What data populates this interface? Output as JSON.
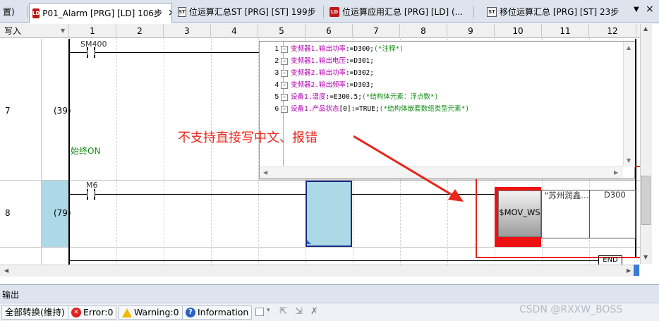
{
  "tabs": [
    {
      "label": "置)",
      "icon": ""
    },
    {
      "label": "P01_Alarm [PRG] [LD] 106步",
      "icon": "LD"
    },
    {
      "label": "位运算汇总ST [PRG] [ST] 199步",
      "icon": "ST"
    },
    {
      "label": "位运算应用汇总 [PRG] [LD] (...",
      "icon": "LD"
    },
    {
      "label": "移位运算汇总 [PRG] [ST] 23步",
      "icon": "ST"
    }
  ],
  "tab_close": "×",
  "tab_controls": {
    "menu": "▼",
    "close": "×"
  },
  "header": {
    "mode_label": "写入",
    "columns": [
      "1",
      "2",
      "3",
      "4",
      "5",
      "6",
      "7",
      "8",
      "9",
      "10",
      "11",
      "12"
    ]
  },
  "rows": [
    {
      "row_number": "7",
      "step": "(39)",
      "contact": "SM400",
      "comment": "始终ON"
    },
    {
      "row_number": "8",
      "step": "(79)",
      "contact": "M6"
    }
  ],
  "code_lines": [
    {
      "no": "1",
      "parts": [
        [
          "mag",
          "变频器1.输出功率"
        ],
        [
          "blk",
          ":=D300;"
        ],
        [
          "grn",
          "(*注释*)"
        ]
      ]
    },
    {
      "no": "2",
      "parts": [
        [
          "mag",
          "变频器1.输出电压"
        ],
        [
          "blk",
          ":=D301;"
        ]
      ]
    },
    {
      "no": "3",
      "parts": [
        [
          "mag",
          "变频器2.输出功率"
        ],
        [
          "blk",
          ":=D302;"
        ]
      ]
    },
    {
      "no": "4",
      "parts": [
        [
          "mag",
          "变频器2.输出频率"
        ],
        [
          "blk",
          ":=D303;"
        ]
      ]
    },
    {
      "no": "5",
      "parts": [
        [
          "mag",
          "设备1.温度"
        ],
        [
          "blk",
          ":=E300.5;"
        ],
        [
          "grn",
          "(*结构体元素：浮点数*)"
        ]
      ]
    },
    {
      "no": "6",
      "parts": [
        [
          "mag",
          "设备1.产品状态"
        ],
        [
          "blk",
          "[0]:=TRUE;"
        ],
        [
          "grn",
          "(*结构体嵌套数组类型元素*)"
        ]
      ]
    }
  ],
  "annotation": {
    "text": "不支持直接写中文、报错",
    "color": "#e8261b"
  },
  "instruction": {
    "name": "$MOV_WS",
    "arg1": "\"苏州润鑫...",
    "arg2": "D300"
  },
  "end_label": "END",
  "output_label": "输出",
  "status": {
    "convert_all": "全部转换(维持)",
    "error": "Error:0",
    "warning": "Warning:0",
    "information": "Information"
  },
  "watermark": "CSDN @RXXW_BOSS",
  "colors": {
    "accent_red": "#e8261b",
    "selection": "#add8e6",
    "instr_red": "#ee1111"
  }
}
